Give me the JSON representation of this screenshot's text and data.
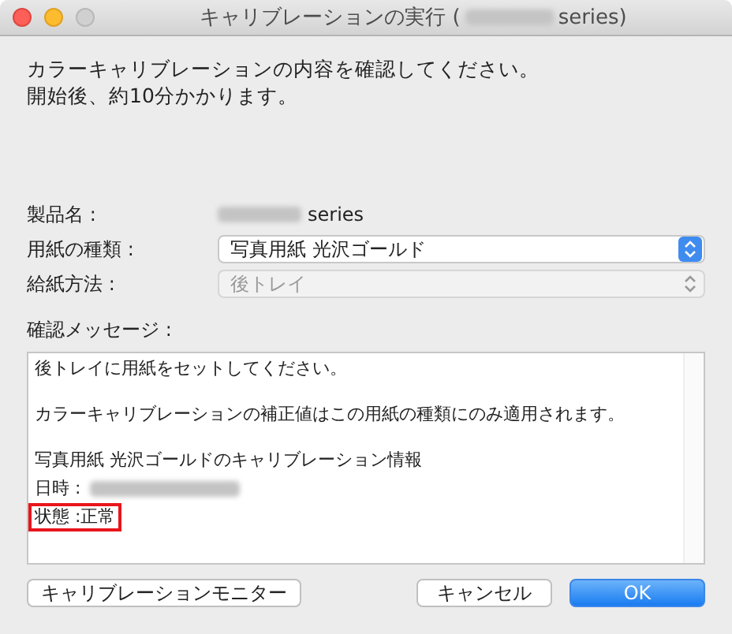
{
  "window": {
    "title_prefix": "キャリブレーションの実行 (",
    "title_suffix": "series)"
  },
  "intro": [
    "カラーキャリブレーションの内容を確認してください。",
    "開始後、約10分かかります。"
  ],
  "fields": [
    {
      "kind": "text",
      "label": "製品名 :",
      "value": "series"
    },
    {
      "kind": "popup",
      "label": "用紙の種類 :",
      "value": "写真用紙 光沢ゴールド",
      "disabled": false
    },
    {
      "kind": "popup",
      "label": "給紙方法 :",
      "value": "後トレイ",
      "disabled": true
    }
  ],
  "message": {
    "label": "確認メッセージ :",
    "paragraphs": [
      [
        {
          "text": "後トレイに用紙をセットしてください。",
          "redacted": false,
          "highlighted": false
        }
      ],
      [
        {
          "text": "カラーキャリブレーションの補正値はこの用紙の種類にのみ適用されます。",
          "redacted": false,
          "highlighted": false
        }
      ],
      [
        {
          "text": "写真用紙 光沢ゴールドのキャリブレーション情報",
          "redacted": false,
          "highlighted": false
        },
        {
          "text": "日時 :",
          "redacted": true,
          "highlighted": false
        },
        {
          "text": "状態 :正常",
          "redacted": false,
          "highlighted": true
        }
      ]
    ]
  },
  "left_buttons": [
    {
      "label": "キャリブレーションモニター",
      "kind": "secondary"
    }
  ],
  "right_buttons": [
    {
      "label": "キャンセル",
      "kind": "secondary"
    },
    {
      "label": "OK",
      "kind": "default"
    }
  ]
}
